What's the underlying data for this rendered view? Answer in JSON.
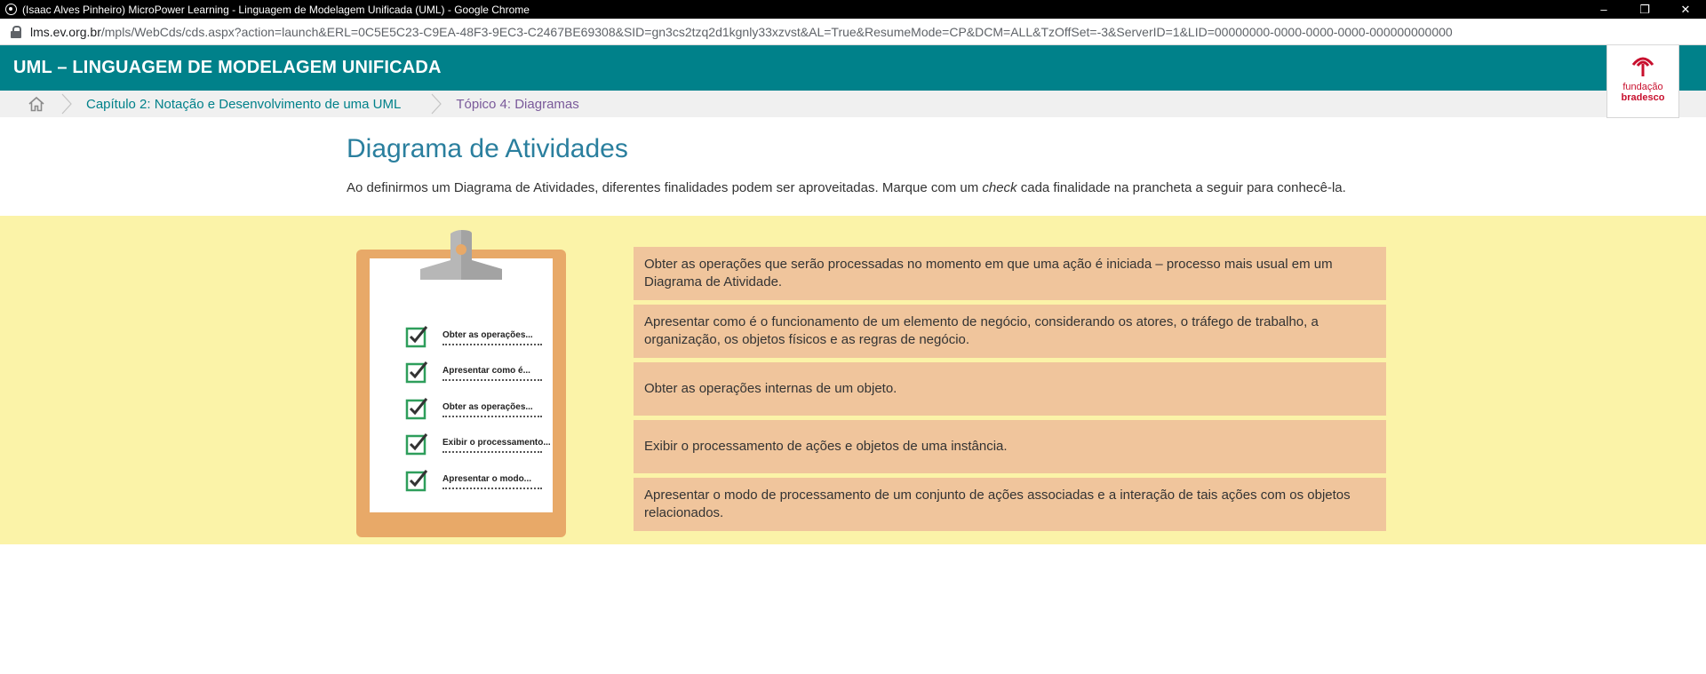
{
  "browser": {
    "window_title": "(Isaac Alves Pinheiro) MicroPower Learning - Linguagem de Modelagem Unificada (UML) - Google Chrome",
    "url_host": "lms.ev.org.br",
    "url_path": "/mpls/WebCds/cds.aspx?action=launch&ERL=0C5E5C23-C9EA-48F3-9EC3-C2467BE69308&SID=gn3cs2tzq2d1kgnly33xzvst&AL=True&ResumeMode=CP&DCM=ALL&TzOffSet=-3&ServerID=1&LID=00000000-0000-0000-0000-000000000000",
    "controls": {
      "minimize": "–",
      "restore": "❐",
      "close": "✕"
    }
  },
  "header": {
    "course_title": "UML – LINGUAGEM DE MODELAGEM UNIFICADA",
    "logo": {
      "line1": "fundação",
      "line2": "bradesco"
    }
  },
  "breadcrumb": {
    "items": [
      {
        "label": "Capítulo 2: Notação e Desenvolvimento de uma UML"
      },
      {
        "label": "Tópico 4: Diagramas"
      }
    ]
  },
  "main": {
    "title": "Diagrama de Atividades",
    "intro_before": "Ao definirmos um Diagrama de Atividades, diferentes finalidades podem ser aproveitadas. Marque com um ",
    "intro_em": "check",
    "intro_after": " cada finalidade na prancheta a seguir para conhecê-la."
  },
  "clipboard": {
    "items": [
      {
        "label": "Obter as operações..."
      },
      {
        "label": "Apresentar como é..."
      },
      {
        "label": "Obter as operações..."
      },
      {
        "label": "Exibir o processamento..."
      },
      {
        "label": "Apresentar o modo..."
      }
    ]
  },
  "options": [
    {
      "text": "Obter as operações que serão processadas no momento em que uma ação é iniciada – processo mais usual em um Diagrama de Atividade."
    },
    {
      "text": "Apresentar como é o funcionamento de um elemento de negócio, considerando os atores, o tráfego de trabalho, a organização, os objetos físicos e as regras de negócio."
    },
    {
      "text": "Obter as operações internas de um objeto."
    },
    {
      "text": "Exibir o processamento de ações e objetos de uma instância."
    },
    {
      "text": "Apresentar o modo de processamento de um conjunto de ações associadas e a interação de tais ações com os objetos relacionados."
    }
  ],
  "colors": {
    "header_teal": "#00818a",
    "band_yellow": "#fbf3a8",
    "option_peach": "#f0c59c",
    "clipboard_orange": "#e8a968",
    "check_green": "#2e9e5b",
    "brand_red": "#c8102e"
  }
}
